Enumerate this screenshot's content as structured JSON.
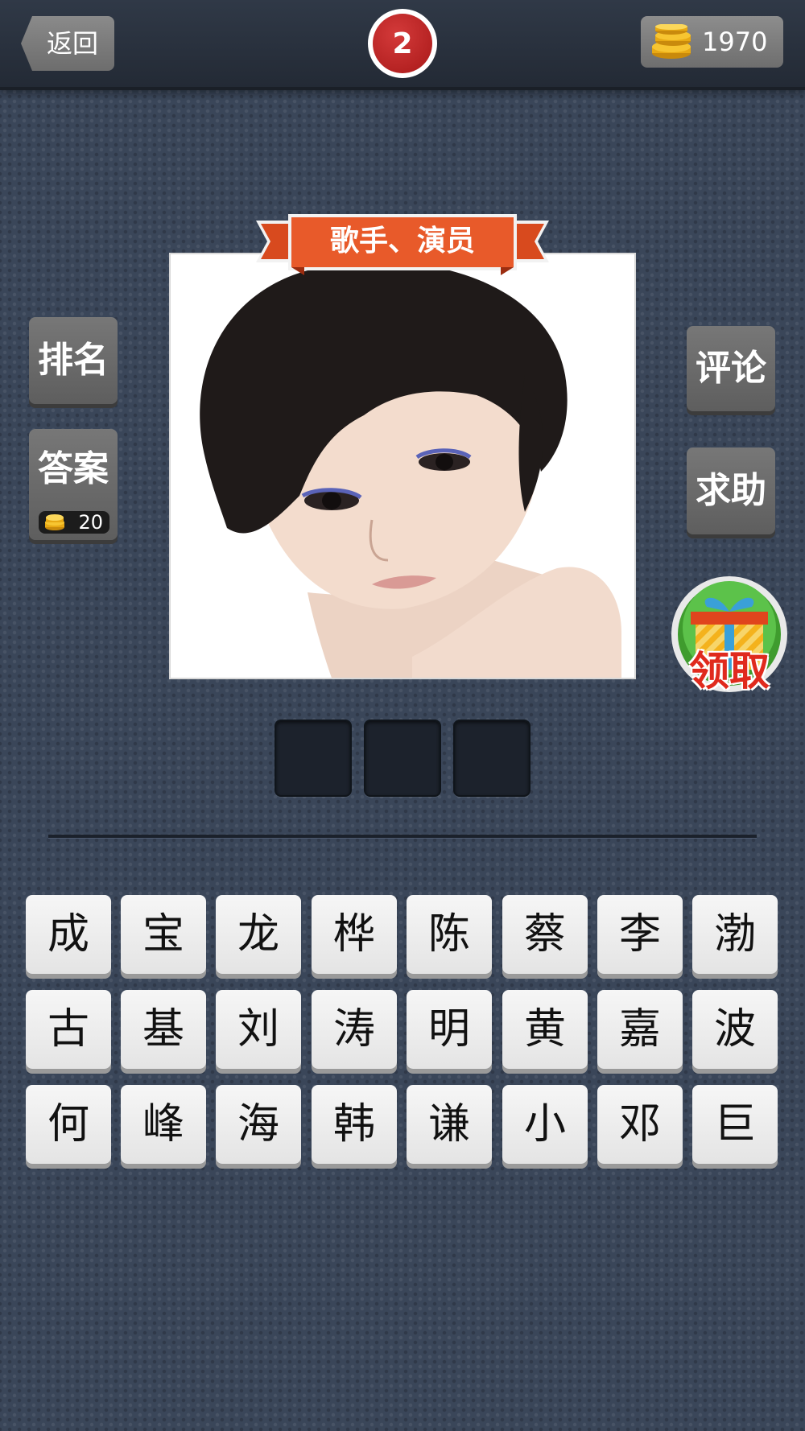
{
  "header": {
    "back_label": "返回",
    "level": "2",
    "coins": "1970"
  },
  "left_buttons": {
    "rank_label": "排名",
    "answer_label": "答案",
    "answer_cost": "20"
  },
  "right_buttons": {
    "comment_label": "评论",
    "help_label": "求助",
    "gift_label": "领取"
  },
  "puzzle": {
    "category": "歌手、演员",
    "answer_slots": 3
  },
  "keyboard": {
    "rows": [
      [
        "成",
        "宝",
        "龙",
        "桦",
        "陈",
        "蔡",
        "李",
        "渤"
      ],
      [
        "古",
        "基",
        "刘",
        "涛",
        "明",
        "黄",
        "嘉",
        "波"
      ],
      [
        "何",
        "峰",
        "海",
        "韩",
        "谦",
        "小",
        "邓",
        "巨"
      ]
    ]
  },
  "colors": {
    "background": "#3a4659",
    "level_badge": "#c12626",
    "ribbon": "#e85a2a",
    "gift_label": "#e02a1d"
  }
}
